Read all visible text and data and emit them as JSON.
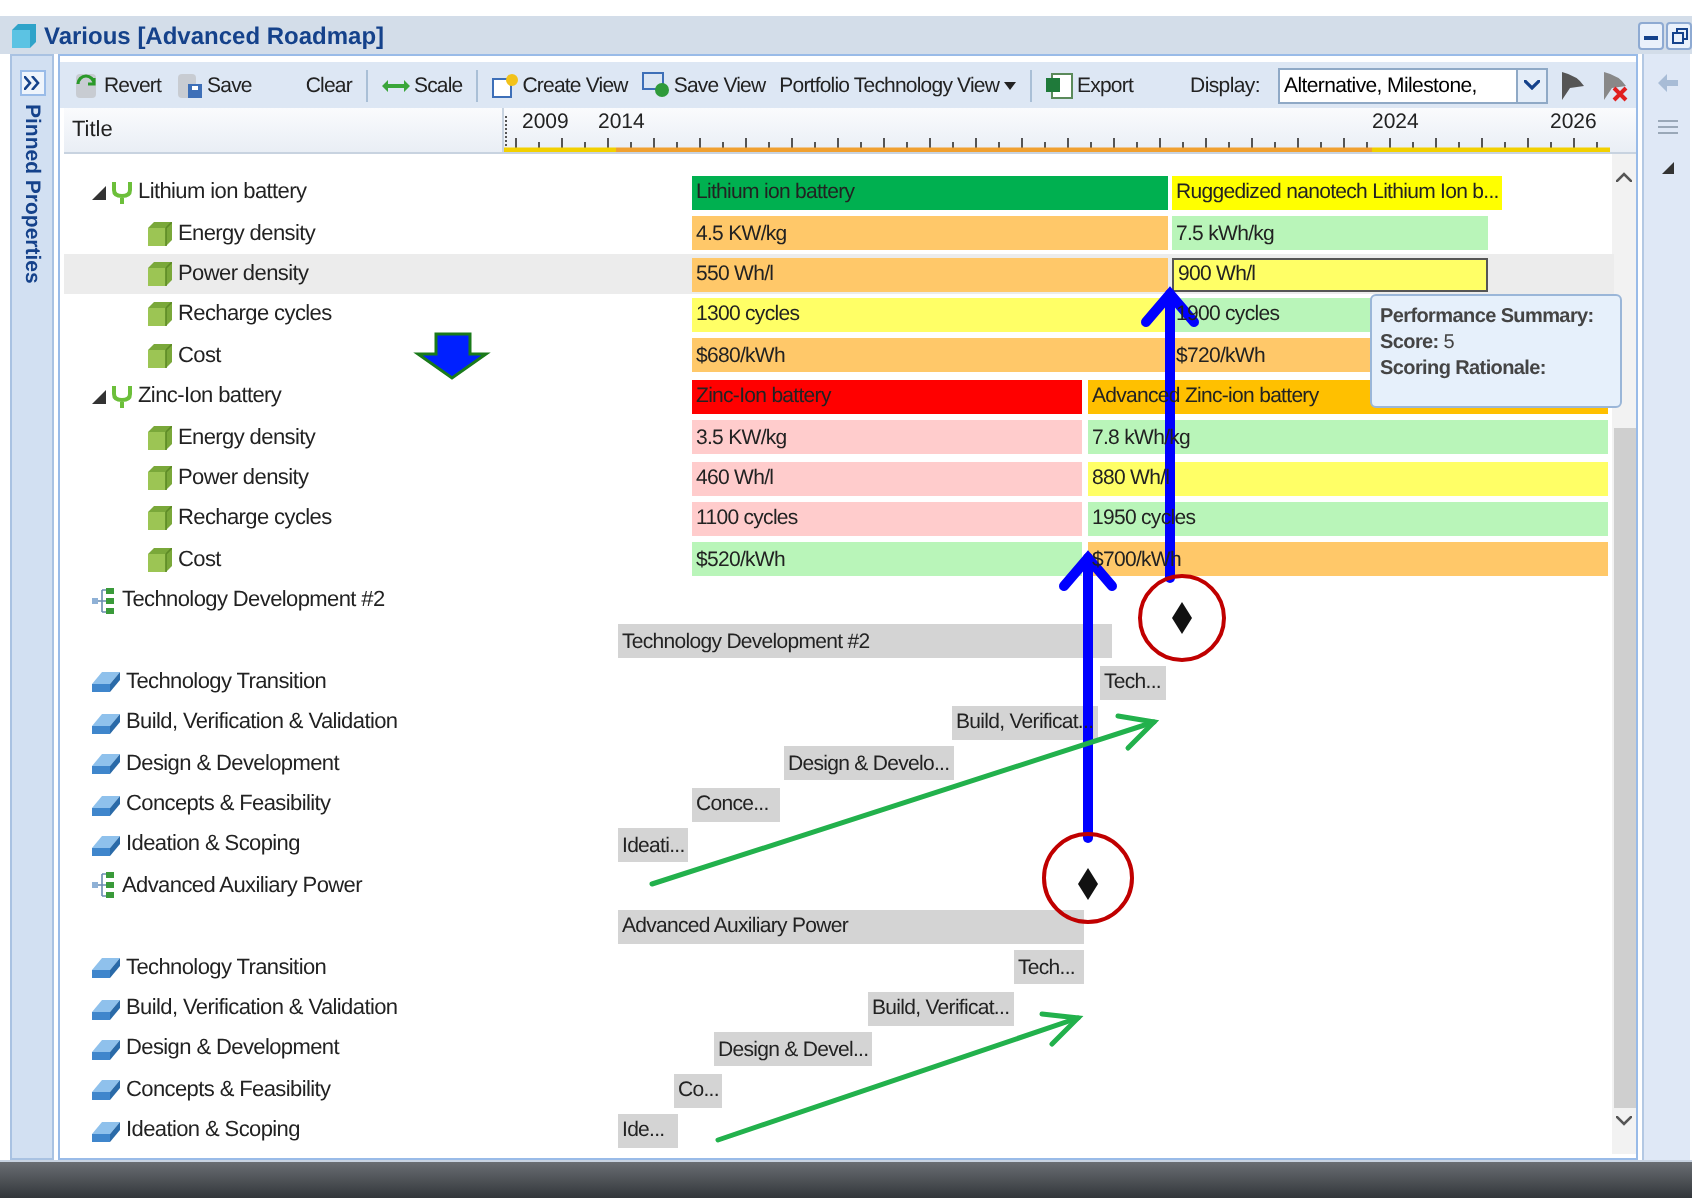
{
  "window": {
    "title": "Various [Advanced Roadmap]"
  },
  "side_panel": {
    "title": "Pinned Properties"
  },
  "toolbar": {
    "revert_button": "Revert",
    "save_button": "Save",
    "clear_button": "Clear",
    "scale_button": "Scale",
    "create_view_button": "Create View",
    "save_view_button": "Save View",
    "view_menu": "Portfolio Technology View",
    "export_button": "Export",
    "display_label": "Display:",
    "display_value": "Alternative, Milestone,"
  },
  "header": {
    "title_column": "Title",
    "years": [
      "2009",
      "2014",
      "2024",
      "2026"
    ]
  },
  "tree": [
    {
      "kind": "technology",
      "label": "Lithium ion battery",
      "expanded": true,
      "selected": false,
      "bars": [
        {
          "text": "Lithium ion battery",
          "color": "#00b050",
          "selected": false
        },
        {
          "text": "Ruggedized nanotech Lithium Ion b...",
          "color": "#ffff00",
          "selected": false
        }
      ],
      "children": [
        {
          "kind": "metric",
          "label": "Energy density",
          "selected": false,
          "bars": [
            {
              "text": "4.5 KW/kg",
              "color": "#ffc869",
              "selected": false
            },
            {
              "text": "7.5 kWh/kg",
              "color": "#b9f5b9",
              "selected": false
            }
          ]
        },
        {
          "kind": "metric",
          "label": "Power density",
          "selected": true,
          "bars": [
            {
              "text": "550 Wh/l",
              "color": "#ffc869",
              "selected": false
            },
            {
              "text": "900 Wh/l",
              "color": "#ffff66",
              "selected": true
            }
          ]
        },
        {
          "kind": "metric",
          "label": "Recharge cycles",
          "selected": false,
          "bars": [
            {
              "text": "1300 cycles",
              "color": "#ffff66",
              "selected": false
            },
            {
              "text": "1900 cycles",
              "color": "#b9f5b9",
              "selected": false
            }
          ]
        },
        {
          "kind": "metric",
          "label": "Cost",
          "selected": false,
          "bars": [
            {
              "text": "$680/kWh",
              "color": "#ffc869",
              "selected": false
            },
            {
              "text": "$720/kWh",
              "color": "#ffc869",
              "selected": false
            }
          ]
        }
      ]
    },
    {
      "kind": "technology",
      "label": "Zinc-Ion battery",
      "expanded": true,
      "selected": false,
      "bars": [
        {
          "text": "Zinc-Ion battery",
          "color": "#ff0000",
          "selected": false
        },
        {
          "text": "Advanced Zinc-ion battery",
          "color": "#ffc000",
          "selected": false
        }
      ],
      "children": [
        {
          "kind": "metric",
          "label": "Energy density",
          "selected": false,
          "bars": [
            {
              "text": "3.5 KW/kg",
              "color": "#ffcccc",
              "selected": false
            },
            {
              "text": "7.8 kWh/kg",
              "color": "#b9f5b9",
              "selected": false
            }
          ]
        },
        {
          "kind": "metric",
          "label": "Power density",
          "selected": false,
          "bars": [
            {
              "text": "460 Wh/l",
              "color": "#ffcccc",
              "selected": false
            },
            {
              "text": "880 Wh/l",
              "color": "#ffff66",
              "selected": false
            }
          ]
        },
        {
          "kind": "metric",
          "label": "Recharge cycles",
          "selected": false,
          "bars": [
            {
              "text": "1100 cycles",
              "color": "#ffcccc",
              "selected": false
            },
            {
              "text": "1950 cycles",
              "color": "#b9f5b9",
              "selected": false
            }
          ]
        },
        {
          "kind": "metric",
          "label": "Cost",
          "selected": false,
          "bars": [
            {
              "text": "$520/kWh",
              "color": "#b9f5b9",
              "selected": false
            },
            {
              "text": "$700/kWh",
              "color": "#ffc869",
              "selected": false
            }
          ]
        }
      ]
    },
    {
      "kind": "program",
      "label": "Technology Development #2",
      "milestone": true,
      "selected": false
    },
    {
      "kind": "summary",
      "selected": false,
      "bars": [
        {
          "text": "Technology Development #2",
          "color": "#d4d4d4",
          "selected": false
        }
      ]
    },
    {
      "kind": "phase",
      "label": "Technology Transition",
      "selected": false,
      "bars": [
        {
          "text": "Tech...",
          "color": "#d4d4d4",
          "selected": false
        }
      ]
    },
    {
      "kind": "phase",
      "label": "Build, Verification & Validation",
      "selected": false,
      "bars": [
        {
          "text": "Build, Verificat...",
          "color": "#d4d4d4",
          "selected": false
        }
      ]
    },
    {
      "kind": "phase",
      "label": "Design & Development",
      "selected": false,
      "bars": [
        {
          "text": "Design & Develo...",
          "color": "#d4d4d4",
          "selected": false
        }
      ]
    },
    {
      "kind": "phase",
      "label": "Concepts & Feasibility",
      "selected": false,
      "bars": [
        {
          "text": "Conce...",
          "color": "#d4d4d4",
          "selected": false
        }
      ]
    },
    {
      "kind": "phase",
      "label": "Ideation & Scoping",
      "selected": false,
      "bars": [
        {
          "text": "Ideati...",
          "color": "#d4d4d4",
          "selected": false
        }
      ]
    },
    {
      "kind": "program",
      "label": "Advanced Auxiliary Power",
      "milestone": true,
      "selected": false
    },
    {
      "kind": "summary",
      "selected": false,
      "bars": [
        {
          "text": "Advanced Auxiliary Power",
          "color": "#d4d4d4",
          "selected": false
        }
      ]
    },
    {
      "kind": "phase",
      "label": "Technology Transition",
      "selected": false,
      "bars": [
        {
          "text": "Tech...",
          "color": "#d4d4d4",
          "selected": false
        }
      ]
    },
    {
      "kind": "phase",
      "label": "Build, Verification & Validation",
      "selected": false,
      "bars": [
        {
          "text": "Build, Verificat...",
          "color": "#d4d4d4",
          "selected": false
        }
      ]
    },
    {
      "kind": "phase",
      "label": "Design & Development",
      "selected": false,
      "bars": [
        {
          "text": "Design & Devel...",
          "color": "#d4d4d4",
          "selected": false
        }
      ]
    },
    {
      "kind": "phase",
      "label": "Concepts & Feasibility",
      "selected": false,
      "bars": [
        {
          "text": "Co...",
          "color": "#d4d4d4",
          "selected": false
        }
      ]
    },
    {
      "kind": "phase",
      "label": "Ideation & Scoping",
      "selected": false,
      "bars": [
        {
          "text": "Ide...",
          "color": "#d4d4d4",
          "selected": false
        }
      ]
    }
  ],
  "tooltip": {
    "title": "Performance Summary:",
    "score": "**Score:** 5",
    "rationale": "Scoring Rationale:"
  }
}
